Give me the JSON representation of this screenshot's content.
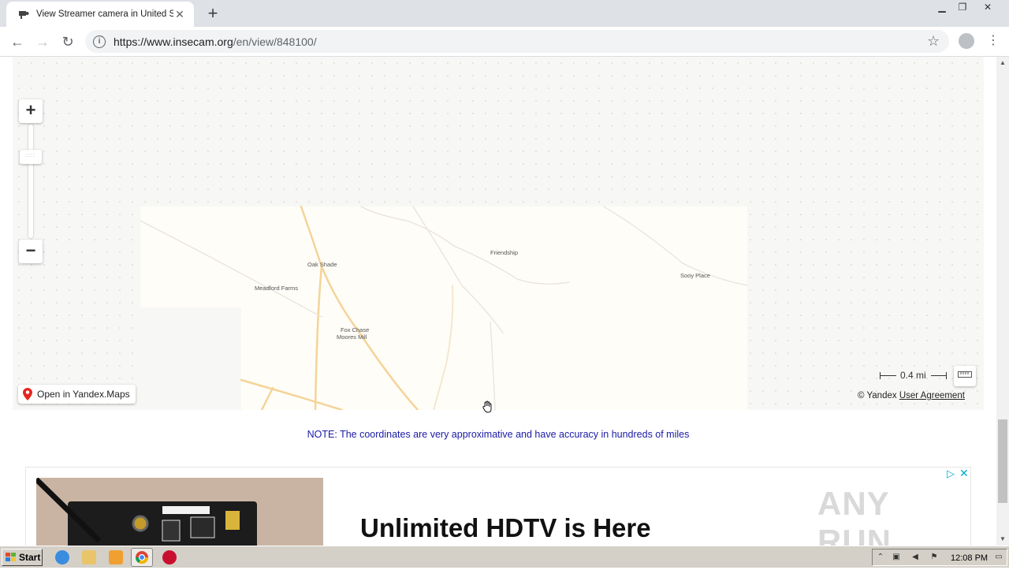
{
  "browser": {
    "tab_title": "View Streamer camera in United Stat",
    "url_host": "https://www.insecam.org",
    "url_path": "/en/view/848100/"
  },
  "map": {
    "labels": [
      {
        "text": "Oak Shade"
      },
      {
        "text": "Meadford Farms"
      },
      {
        "text": "Friendship"
      },
      {
        "text": "Sooy Place"
      },
      {
        "text": "Fox Chase"
      },
      {
        "text": "Moores Mill"
      }
    ],
    "open_in_yandex": "Open in Yandex.Maps",
    "scale_label": "0.4 mi",
    "copyright": "© Yandex",
    "user_agreement": "User Agreement",
    "zoom_in": "+",
    "zoom_out": "−"
  },
  "note": "NOTE: The coordinates are very approximative and have accuracy in hundreds of miles",
  "ad": {
    "headline": "Unlimited HDTV is Here",
    "watermark": "ANY RUN"
  },
  "taskbar": {
    "start": "Start",
    "clock": "12:08 PM"
  },
  "colors": {
    "note_text": "#1a1aa6",
    "road": "#f4d49a",
    "tile": "#fffdf7",
    "ad_accent": "#00aecd"
  }
}
